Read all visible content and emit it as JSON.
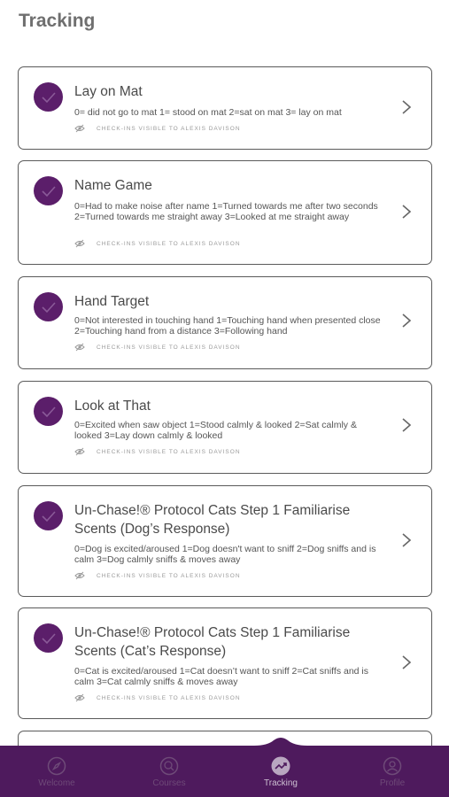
{
  "header": {
    "title": "Tracking"
  },
  "colors": {
    "accent": "#5b1e6a",
    "nav_bg": "#4e1a5d"
  },
  "cards": [
    {
      "title": "Lay on Mat",
      "description": "0= did not go to mat 1= stood on mat 2=sat on mat 3= lay on mat",
      "visibility": "CHECK-INS VISIBLE TO ALEXIS DAVISON"
    },
    {
      "title": "Name Game",
      "description": "0=Had to make noise after name 1=Turned towards me after two seconds 2=Turned towards me straight away 3=Looked at me straight away",
      "visibility": "CHECK-INS VISIBLE TO ALEXIS DAVISON"
    },
    {
      "title": "Hand Target",
      "description": "0=Not interested in touching hand  1=Touching hand when presented close  2=Touching hand from a distance 3=Following hand",
      "visibility": "CHECK-INS VISIBLE TO ALEXIS DAVISON"
    },
    {
      "title": "Look at That",
      "description": "0=Excited when saw object    1=Stood calmly & looked  2=Sat calmly & looked 3=Lay down calmly & looked",
      "visibility": "CHECK-INS VISIBLE TO ALEXIS DAVISON"
    },
    {
      "title": "Un-Chase!® Protocol Cats Step 1 Familiarise Scents (Dog’s Response)",
      "description": "0=Dog is excited/aroused 1=Dog doesn't want to sniff  2=Dog sniffs and is calm  3=Dog calmly sniffs & moves away",
      "visibility": "CHECK-INS VISIBLE TO ALEXIS DAVISON"
    },
    {
      "title": "Un-Chase!® Protocol Cats Step 1 Familiarise Scents (Cat’s Response)",
      "description": "0=Cat is excited/aroused 1=Cat doesn’t want to sniff  2=Cat sniffs and is calm  3=Cat calmly sniffs & moves away",
      "visibility": "CHECK-INS VISIBLE TO ALEXIS DAVISON"
    }
  ],
  "nav": {
    "items": [
      {
        "label": "Welcome",
        "icon": "compass-icon",
        "active": false
      },
      {
        "label": "Courses",
        "icon": "magnifier-icon",
        "active": false
      },
      {
        "label": "Tracking",
        "icon": "trend-chart-icon",
        "active": true
      },
      {
        "label": "Profile",
        "icon": "user-circle-icon",
        "active": false
      }
    ]
  }
}
